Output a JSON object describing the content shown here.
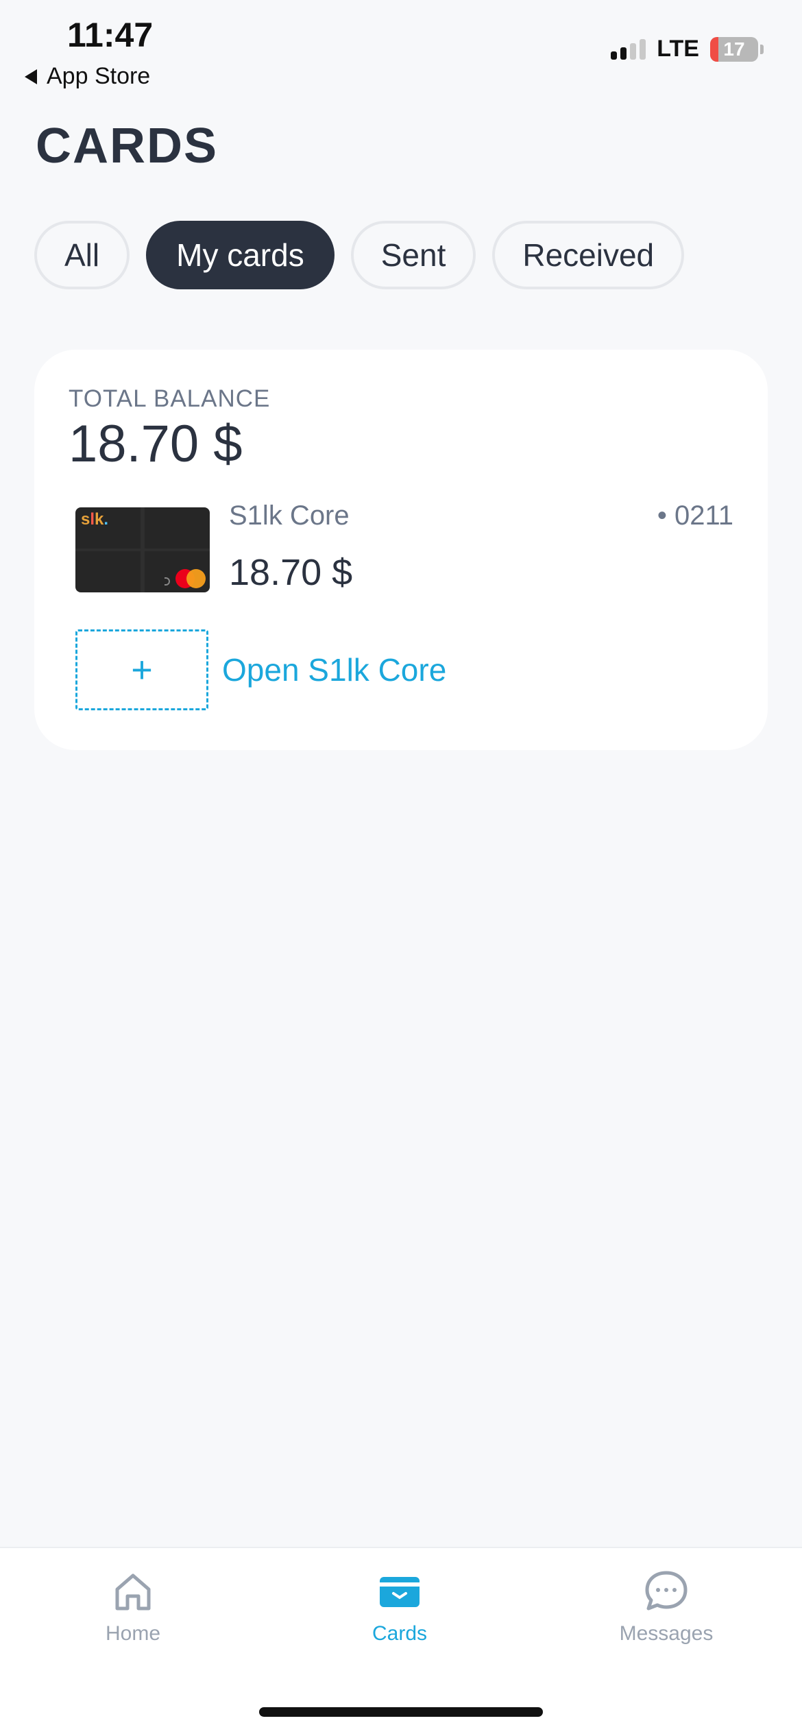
{
  "status_bar": {
    "time": "11:47",
    "back_label": "App Store",
    "network": "LTE",
    "battery": "17",
    "battery_percent": 17
  },
  "page": {
    "title": "CARDS"
  },
  "tabs": [
    {
      "label": "All",
      "active": false
    },
    {
      "label": "My cards",
      "active": true
    },
    {
      "label": "Sent",
      "active": false
    },
    {
      "label": "Received",
      "active": false
    }
  ],
  "balance": {
    "label": "TOTAL BALANCE",
    "value": "18.70 $"
  },
  "card": {
    "name": "S1lk Core",
    "last4": "• 0211",
    "balance": "18.70 $"
  },
  "open_card": {
    "icon": "+",
    "label": "Open S1lk Core"
  },
  "nav": [
    {
      "label": "Home",
      "icon": "home-icon",
      "active": false
    },
    {
      "label": "Cards",
      "icon": "wallet-icon",
      "active": true
    },
    {
      "label": "Messages",
      "icon": "chat-icon",
      "active": false
    }
  ],
  "colors": {
    "accent": "#1ba7dc",
    "dark": "#2b3240",
    "muted": "#6b7689",
    "background": "#f7f8fa",
    "battery_low": "#f04d45"
  }
}
